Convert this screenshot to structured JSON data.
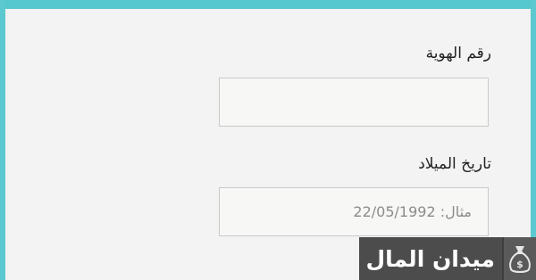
{
  "form": {
    "id_label": "رقم الهوية",
    "id_value": "",
    "dob_label": "تاريخ الميلاد",
    "dob_placeholder": "مثال: 22/05/1992",
    "dob_value": ""
  },
  "watermark": {
    "text": "ميدان المال",
    "icon": "money-bag-icon"
  },
  "colors": {
    "accent": "#55c8cf",
    "background": "#f2f3f2",
    "field_border": "#c9c9c9",
    "watermark_bg": "#4c4c4c"
  }
}
